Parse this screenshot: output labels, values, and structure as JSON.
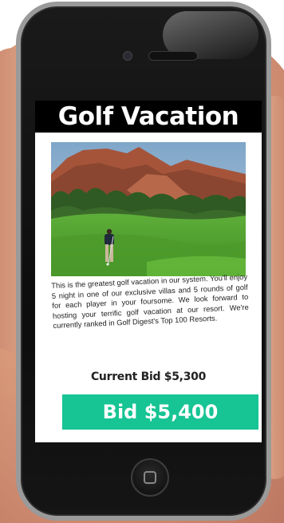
{
  "screen": {
    "title": "Golf Vacation",
    "photo_icon": "golf-course-photo",
    "description": "This is the greatest golf vacation in our system. You'll enjoy 5 night in one of our exclusive villas and 5 rounds of golf for each player in your foursome. We look forward to hosting your terrific golf vacation at our resort. We're currently ranked in Golf Digest's Top 100 Resorts.",
    "current_bid": "Current Bid $5,300",
    "bid_button_label": "Bid $5,400"
  },
  "colors": {
    "title_bar": "#000000",
    "bid_button": "#16c494",
    "screen_background": "#ffffff"
  },
  "device": {
    "home_icon": "home-button-icon"
  }
}
